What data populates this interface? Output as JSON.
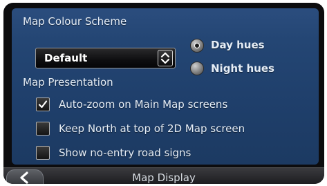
{
  "map_colour_scheme": {
    "label": "Map Colour Scheme",
    "dropdown_value": "Default",
    "options": [
      {
        "label": "Day hues",
        "selected": true
      },
      {
        "label": "Night hues",
        "selected": false
      }
    ]
  },
  "map_presentation": {
    "label": "Map Presentation",
    "checkboxes": [
      {
        "label": "Auto-zoom on Main Map screens",
        "checked": true
      },
      {
        "label": "Keep North at top of 2D Map screen",
        "checked": false
      },
      {
        "label": "Show no-entry road signs",
        "checked": false
      }
    ]
  },
  "bottom_bar": {
    "title": "Map Display",
    "back_icon": "chevron-left-icon"
  }
}
